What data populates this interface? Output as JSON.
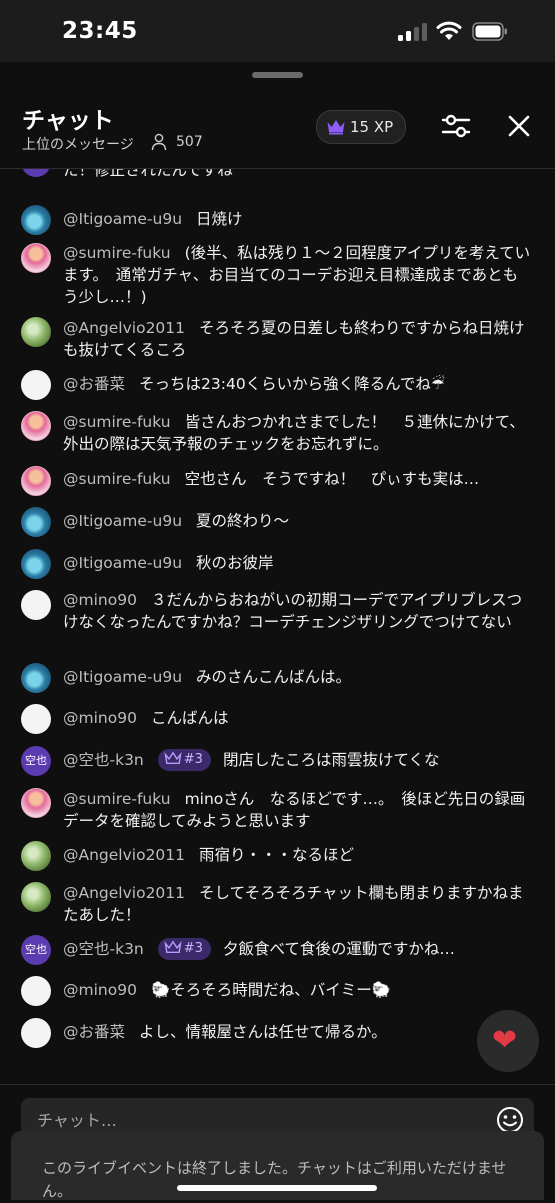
{
  "status_bar": {
    "time": "23:45"
  },
  "header": {
    "title": "チャット",
    "subtitle": "上位のメッセージ",
    "viewer_count": "507",
    "xp": "15 XP"
  },
  "partial_message": {
    "text": "た！修正されたんですね"
  },
  "messages": [
    {
      "author": "@Itigoame-u9u",
      "text": "日焼け"
    },
    {
      "author": "@sumire-fuku",
      "text": "(後半、私は残り１〜２回程度アイプリを考えています。　通常ガチャ、お目当てのコーデお迎え目標達成まであともう少し…！)"
    },
    {
      "author": "@Angelvio2011",
      "text": "そろそろ夏の日差しも終わりですからね日焼けも抜けてくるころ"
    },
    {
      "author": "@お番菜",
      "text": "そっちは23:40くらいから強く降るんでね☔"
    },
    {
      "author": "@sumire-fuku",
      "text": "皆さんおつかれさまでした！　５連休にかけて、外出の際は天気予報のチェックをお忘れずに。"
    },
    {
      "author": "@sumire-fuku",
      "text": "空也さん　そうですね！　ぴぃすも実は…"
    },
    {
      "author": "@Itigoame-u9u",
      "text": "夏の終わり〜"
    },
    {
      "author": "@Itigoame-u9u",
      "text": "秋のお彼岸"
    },
    {
      "author": "@mino90",
      "text": "３だんからおねがいの初期コーデでアイプリブレスつけなくなったんですかね？コーデチェンジザリングでつけてない"
    },
    {
      "author": "@Itigoame-u9u",
      "text": "みのさんこんばんは。"
    },
    {
      "author": "@mino90",
      "text": "こんばんは"
    },
    {
      "author": "@空也-k3n",
      "badge": "#3",
      "avatar_label": "空也",
      "text": "閉店したころは雨雲抜けてくな"
    },
    {
      "author": "@sumire-fuku",
      "text": "minoさん　なるほどです…。　後ほど先日の録画データを確認してみようと思います"
    },
    {
      "author": "@Angelvio2011",
      "text": "雨宿り・・・なるほど"
    },
    {
      "author": "@Angelvio2011",
      "text": "そしてそろそろチャット欄も閉まりますかねまたあした！"
    },
    {
      "author": "@空也-k3n",
      "badge": "#3",
      "avatar_label": "空也",
      "text": "夕飯食べて食後の運動ですかね…"
    },
    {
      "author": "@mino90",
      "text": "🐑そろそろ時間だね、バイミー🐑"
    },
    {
      "author": "@お番菜",
      "text": "よし、情報屋さんは任せて帰るか。"
    }
  ],
  "chat_input": {
    "placeholder": "チャット…"
  },
  "ended_notice": {
    "text": "このライブイベントは終了しました。チャットはご利用いただけません。"
  },
  "colors": {
    "accent_purple": "#5b3bb0",
    "heart": "#e23a44"
  }
}
